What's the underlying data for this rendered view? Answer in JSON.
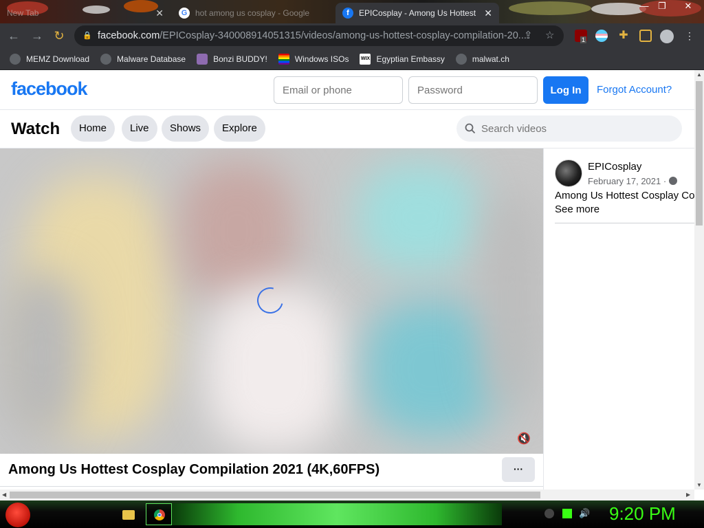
{
  "tabs": [
    {
      "title": "New Tab",
      "favicon": "blank-icon",
      "active": false
    },
    {
      "title": "hot among us cosplay - Google",
      "favicon": "google-icon",
      "active": false
    },
    {
      "title": "EPICosplay - Among Us Hottest",
      "favicon": "facebook-icon",
      "active": true
    }
  ],
  "toolbar": {
    "url_host": "facebook.com",
    "url_path": "/EPICosplay-340008914051315/videos/among-us-hottest-cosplay-compilation-20...",
    "extension_badge": "1"
  },
  "bookmarks": [
    {
      "label": "MEMZ Download",
      "icon": "globe-icon"
    },
    {
      "label": "Malware Database",
      "icon": "globe-icon"
    },
    {
      "label": "Bonzi BUDDY!",
      "icon": "bonzi-icon"
    },
    {
      "label": "Windows ISOs",
      "icon": "rainbow-flag-icon"
    },
    {
      "label": "Egyptian Embassy",
      "icon": "wix-icon"
    },
    {
      "label": "malwat.ch",
      "icon": "globe-icon"
    }
  ],
  "fb_header": {
    "logo": "facebook",
    "email_placeholder": "Email or phone",
    "password_placeholder": "Password",
    "login_label": "Log In",
    "forgot_label": "Forgot Account?"
  },
  "watch": {
    "title": "Watch",
    "nav": [
      "Home",
      "Live",
      "Shows",
      "Explore"
    ],
    "search_placeholder": "Search videos"
  },
  "video": {
    "title": "Among Us Hottest Cosplay Compilation 2021 (4K,60FPS)",
    "more_label": "···",
    "loading": true,
    "muted": true
  },
  "post": {
    "page_name": "EPICosplay",
    "date": "February 17, 2021 ·",
    "description": "Among Us Hottest Cosplay Com",
    "see_more": "See more"
  },
  "taskbar": {
    "clock": "9:20 PM"
  },
  "colors": {
    "fb_blue": "#1877f2",
    "clock_green": "#39ff14",
    "chrome_dark": "#35363a"
  }
}
